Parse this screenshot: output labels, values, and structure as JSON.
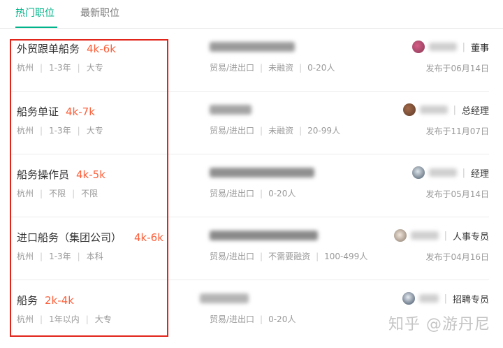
{
  "tabs": [
    {
      "label": "热门职位",
      "active": true
    },
    {
      "label": "最新职位",
      "active": false
    }
  ],
  "jobs": [
    {
      "title": "外贸跟单船务",
      "salary": "4k-6k",
      "tags": [
        "杭州",
        "1-3年",
        "大专"
      ],
      "company_tags": [
        "贸易/进出口",
        "未融资",
        "0-20人"
      ],
      "hr_role": "董事",
      "date": "发布于06月14日"
    },
    {
      "title": "船务单证",
      "salary": "4k-7k",
      "tags": [
        "杭州",
        "1-3年",
        "大专"
      ],
      "company_tags": [
        "贸易/进出口",
        "未融资",
        "20-99人"
      ],
      "hr_role": "总经理",
      "date": "发布于11月07日"
    },
    {
      "title": "船务操作员",
      "salary": "4k-5k",
      "tags": [
        "杭州",
        "不限",
        "不限"
      ],
      "company_tags": [
        "贸易/进出口",
        "0-20人"
      ],
      "hr_role": "经理",
      "date": "发布于05月14日"
    },
    {
      "title": "进口船务（集团公司）",
      "salary": "4k-6k",
      "tags": [
        "杭州",
        "1-3年",
        "本科"
      ],
      "company_tags": [
        "贸易/进出口",
        "不需要融资",
        "100-499人"
      ],
      "hr_role": "人事专员",
      "date": "发布于04月16日"
    },
    {
      "title": "船务",
      "salary": "2k-4k",
      "tags": [
        "杭州",
        "1年以内",
        "大专"
      ],
      "company_tags": [
        "贸易/进出口",
        "0-20人"
      ],
      "hr_role": "招聘专员",
      "date": ""
    }
  ],
  "watermark": "知乎 @游丹尼",
  "colors": {
    "accent": "#00b38a",
    "salary": "#fd5f39",
    "highlight": "#e1251b"
  }
}
